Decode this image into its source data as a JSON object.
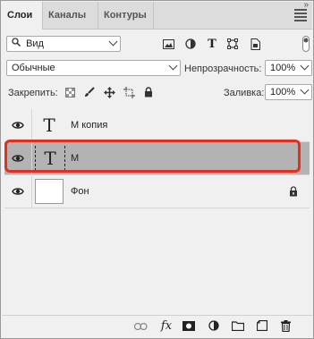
{
  "tabs": [
    {
      "label": "Слои",
      "active": true
    },
    {
      "label": "Каналы",
      "active": false
    },
    {
      "label": "Контуры",
      "active": false
    }
  ],
  "filter": {
    "kind_label": "Вид",
    "icons": [
      "search-icon",
      "image-filter-icon",
      "adjustment-filter-icon",
      "type-filter-icon",
      "shape-filter-icon",
      "smart-object-filter-icon",
      "filter-toggle"
    ]
  },
  "blend": {
    "mode": "Обычные",
    "opacity_label": "Непрозрачность:",
    "opacity_value": "100%"
  },
  "lock": {
    "label": "Закрепить:",
    "fill_label": "Заливка:",
    "fill_value": "100%"
  },
  "layers": [
    {
      "name": "М копия",
      "type": "text",
      "thumb": "T",
      "selected": false,
      "visible": true
    },
    {
      "name": "М",
      "type": "text",
      "thumb": "T",
      "selected": true,
      "visible": true
    },
    {
      "name": "Фон",
      "type": "raster",
      "thumb": "",
      "selected": false,
      "visible": true,
      "locked": true
    }
  ],
  "accent_color": "#e03020",
  "bottom_icons": [
    "link-icon",
    "fx-icon",
    "mask-icon",
    "adjustment-icon",
    "folder-icon",
    "new-layer-icon",
    "trash-icon"
  ]
}
